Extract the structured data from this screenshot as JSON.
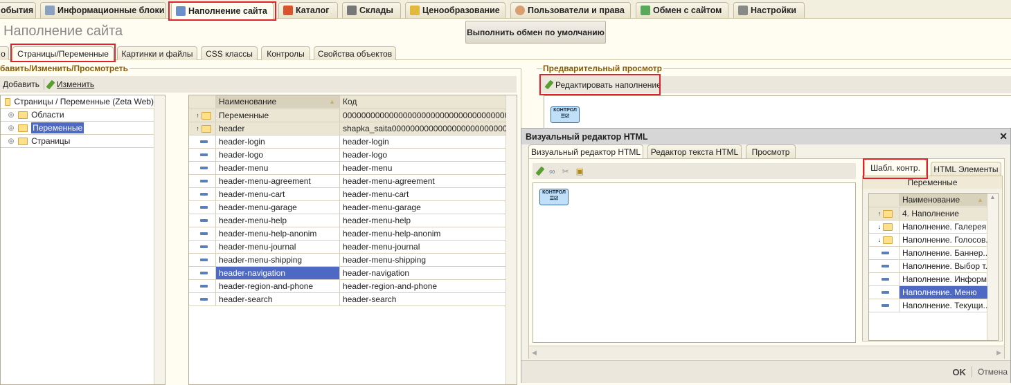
{
  "top_tabs": [
    {
      "label": "обытия"
    },
    {
      "label": "Информационные блоки"
    },
    {
      "label": "Наполнение сайта"
    },
    {
      "label": "Каталог"
    },
    {
      "label": "Склады"
    },
    {
      "label": "Ценообразование"
    },
    {
      "label": "Пользователи и права"
    },
    {
      "label": "Обмен с сайтом"
    },
    {
      "label": "Настройки"
    }
  ],
  "page_title": "Наполнение сайта",
  "exchange_button": "Выполнить обмен по умолчанию",
  "sub_tabs": [
    {
      "label": "о"
    },
    {
      "label": "Страницы/Переменные"
    },
    {
      "label": "Картинки и файлы"
    },
    {
      "label": "CSS классы"
    },
    {
      "label": "Контролы"
    },
    {
      "label": "Свойства объектов"
    }
  ],
  "left_group": {
    "title": "бавить/Изменить/Просмотреть",
    "add": "Добавить",
    "edit": "Изменить"
  },
  "tree": {
    "root": "Страницы / Переменные (Zeta Web)",
    "items": [
      "Области",
      "Переменные",
      "Страницы"
    ]
  },
  "table": {
    "columns": [
      "Наименование",
      "Код"
    ],
    "rows": [
      {
        "name": "Переменные",
        "code": "000000000000000000000000000000000000...",
        "type": "folder-up"
      },
      {
        "name": "header",
        "code": "shapka_saita0000000000000000000000000...",
        "type": "folder-up"
      },
      {
        "name": "header-login",
        "code": "header-login",
        "type": "item"
      },
      {
        "name": "header-logo",
        "code": "header-logo",
        "type": "item"
      },
      {
        "name": "header-menu",
        "code": "header-menu",
        "type": "item"
      },
      {
        "name": "header-menu-agreement",
        "code": "header-menu-agreement",
        "type": "item"
      },
      {
        "name": "header-menu-cart",
        "code": "header-menu-cart",
        "type": "item"
      },
      {
        "name": "header-menu-garage",
        "code": "header-menu-garage",
        "type": "item"
      },
      {
        "name": "header-menu-help",
        "code": "header-menu-help",
        "type": "item"
      },
      {
        "name": "header-menu-help-anonim",
        "code": "header-menu-help-anonim",
        "type": "item"
      },
      {
        "name": "header-menu-journal",
        "code": "header-menu-journal",
        "type": "item"
      },
      {
        "name": "header-menu-shipping",
        "code": "header-menu-shipping",
        "type": "item"
      },
      {
        "name": "header-navigation",
        "code": "header-navigation",
        "type": "item",
        "selected": true
      },
      {
        "name": "header-region-and-phone",
        "code": "header-region-and-phone",
        "type": "item"
      },
      {
        "name": "header-search",
        "code": "header-search",
        "type": "item"
      }
    ]
  },
  "preview": {
    "title": "Предварительный просмотр",
    "edit_button": "Редактировать наполнение",
    "control_label": "КОНТРОЛ"
  },
  "dialog": {
    "title": "Визуальный редактор HTML",
    "close": "✕",
    "tabs": [
      "Визуальный редактор HTML",
      "Редактор текста HTML",
      "Просмотр"
    ],
    "control_label": "КОНТРОЛ",
    "side_tabs": [
      "Шабл. контр.",
      "HTML Элементы"
    ],
    "side_subtitle": "Переменные",
    "side_column": "Наименование",
    "side_rows": [
      {
        "name": "4. Наполнение",
        "type": "folder-up"
      },
      {
        "name": "Наполнение. Галерея",
        "type": "folder-down"
      },
      {
        "name": "Наполнение. Голосов...",
        "type": "folder-down"
      },
      {
        "name": "Наполнение. Баннер...",
        "type": "item"
      },
      {
        "name": "Наполнение. Выбор т...",
        "type": "item"
      },
      {
        "name": "Наполнение. Информ...",
        "type": "item"
      },
      {
        "name": "Наполнение. Меню",
        "type": "item",
        "selected": true
      },
      {
        "name": "Наполнение. Текущи...",
        "type": "item"
      }
    ],
    "ok": "OK",
    "cancel": "Отмена"
  }
}
